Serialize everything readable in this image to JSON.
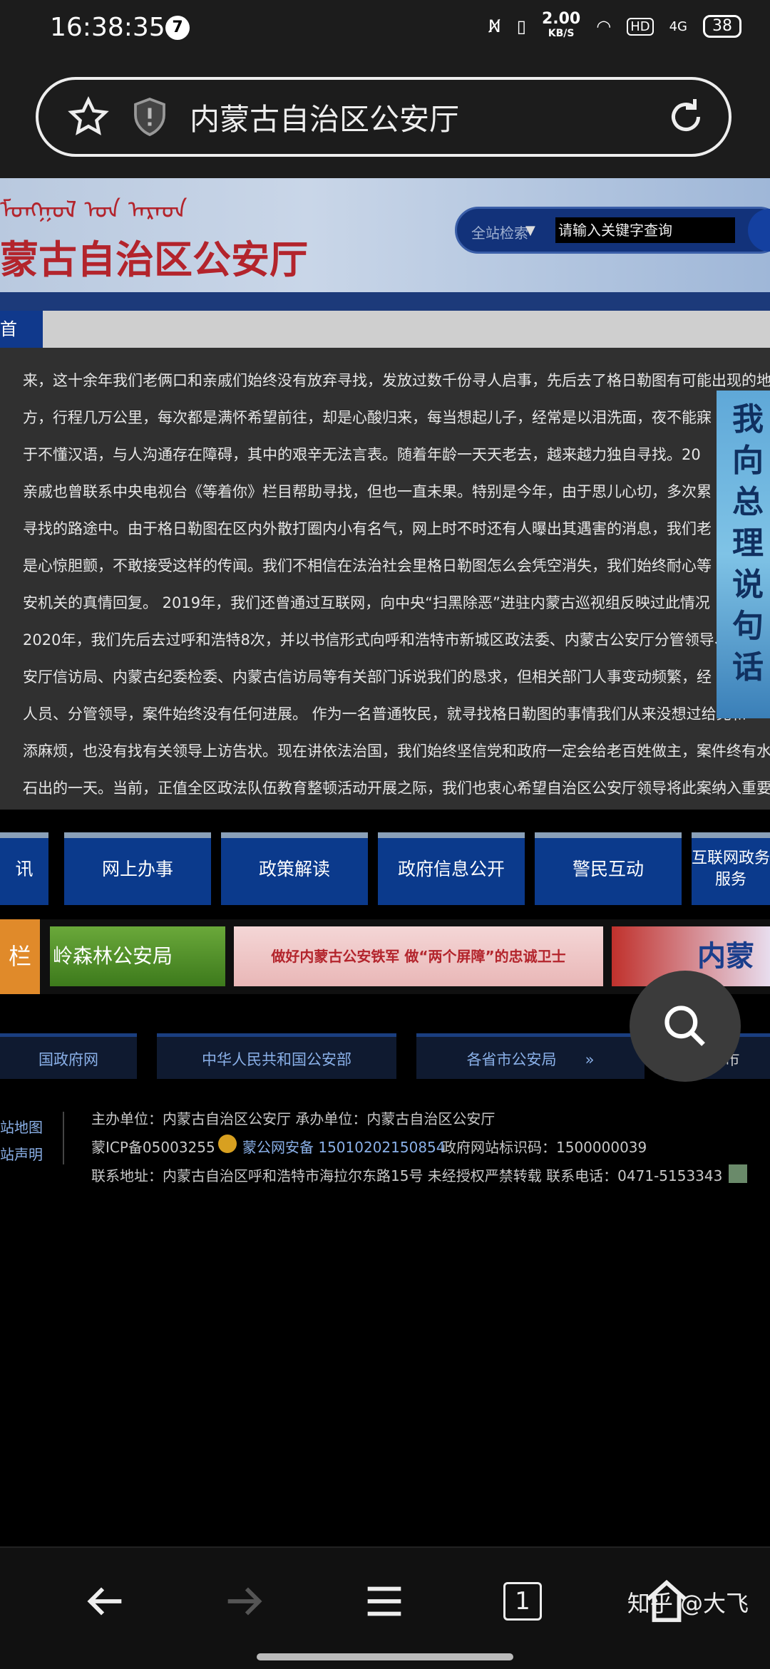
{
  "status_bar": {
    "time": "16:38:35",
    "notification_count": "7",
    "net_speed": "2.00",
    "net_unit": "KB/S",
    "hd": "HD",
    "signal": "4G",
    "battery": "38"
  },
  "browser": {
    "page_title": "内蒙古自治区公安厅"
  },
  "header": {
    "mongolian_script": "ᠮᠣᠩᠭᠣᠯ ᠤᠨ ᠠᠷᠠᠳ",
    "site_name": "蒙古自治区公安厅",
    "search_category": "全站检索",
    "search_placeholder": "请输入关键字查询"
  },
  "notice": {
    "tab_label": "首",
    "paragraph_lines": [
      "来，这十余年我们老俩口和亲戚们始终没有放弃寻找，发放过数千份寻人启事，先后去了格日勒图有可能出现的地",
      "方，行程几万公里，每次都是满怀希望前往，却是心酸归来，每当想起儿子，经常是以泪洗面，夜不能寐",
      "于不懂汉语，与人沟通存在障碍，其中的艰辛无法言表。随着年龄一天天老去，越来越力独自寻找。20",
      "亲戚也曾联系中央电视台《等着你》栏目帮助寻找，但也一直未果。特别是今年，由于思儿心切，多次累",
      "寻找的路途中。由于格日勒图在区内外散打圈内小有名气，网上时不时还有人曝出其遇害的消息，我们老",
      "是心惊胆颤，不敢接受这样的传闻。我们不相信在法治社会里格日勒图怎么会凭空消失，我们始终耐心等",
      "安机关的真情回复。   2019年，我们还曾通过互联网，向中央“扫黑除恶”进驻内蒙古巡视组反映过此情况",
      "2020年，我们先后去过呼和浩特8次，并以书信形式向呼和浩特市新城区政法委、内蒙古公安厅分管领导、",
      "安厅信访局、内蒙古纪委检委、内蒙古信访局等有关部门诉说我们的恳求，但相关部门人事变动频繁，经",
      "人员、分管领导，案件始终没有任何进展。   作为一名普通牧民，就寻找格日勒图的事情我们从来没想过给党和",
      "添麻烦，也没有找有关领导上访告状。现在讲依法治国，我们始终坚信党和政府一定会给老百姓做主，案件终有水",
      "石出的一天。当前，正值全区政法队伍教育整顿活动开展之际，我们也衷心希望自治区公安厅领导将此案纳入重要"
    ],
    "side_banner_chars": [
      "我",
      "向",
      "总",
      "理",
      "说",
      "句",
      "话"
    ]
  },
  "nav_buttons": [
    "讯",
    "网上办事",
    "政策解读",
    "政府信息公开",
    "警民互动",
    "互联网政务服务"
  ],
  "links_row": {
    "left_tag": "栏",
    "items": [
      "岭森林公安局",
      "做好内蒙古公安铁军 做“两个屏障”的忠诚卫士",
      "内蒙"
    ]
  },
  "footer_links": [
    "国政府网",
    "中华人民共和国公安部",
    "各省市公安局",
    "各盟市"
  ],
  "footer": {
    "side_links": [
      "站地图",
      "站声明"
    ],
    "line1": "主办单位：内蒙古自治区公安厅   承办单位：内蒙古自治区公安厅",
    "icp": "蒙ICP备05003255",
    "police_record": "蒙公网安备 15010202150854",
    "site_code": "政府网站标识码：1500000039",
    "line3": "联系地址：内蒙古自治区呼和浩特市海拉尔东路15号   未经授权严禁转载   联系电话：0471-5153343"
  },
  "bottom_nav": {
    "tab_count": "1"
  },
  "watermark": "知乎 @大飞",
  "colors": {
    "nav_blue": "#0b3a8c",
    "brand_red": "#b3242c"
  }
}
